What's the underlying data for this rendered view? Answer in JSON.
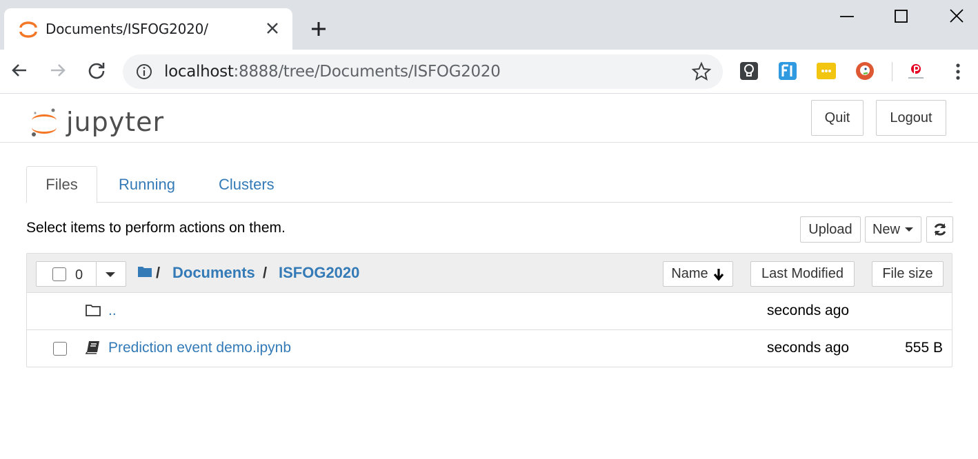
{
  "browser": {
    "tab_title": "Documents/ISFOG2020/",
    "url_host": "localhost",
    "url_rest": ":8888/tree/Documents/ISFOG2020",
    "extension_icons": [
      "lightbulb-icon",
      "fi-icon",
      "dots-icon",
      "duckduckgo-icon",
      "pinterest-icon"
    ]
  },
  "header": {
    "logo_text": "jupyter",
    "quit_label": "Quit",
    "logout_label": "Logout"
  },
  "tabs": [
    {
      "label": "Files",
      "active": true
    },
    {
      "label": "Running",
      "active": false
    },
    {
      "label": "Clusters",
      "active": false
    }
  ],
  "actions": {
    "hint": "Select items to perform actions on them.",
    "upload_label": "Upload",
    "new_label": "New"
  },
  "list": {
    "selected_count": "0",
    "breadcrumb": [
      "Documents",
      "ISFOG2020"
    ],
    "breadcrumb_sep": "/",
    "columns": {
      "name": "Name",
      "last_modified": "Last Modified",
      "file_size": "File size"
    },
    "rows": [
      {
        "name": "..",
        "modified": "seconds ago",
        "size": ""
      },
      {
        "name": "Prediction event demo.ipynb",
        "modified": "seconds ago",
        "size": "555 B"
      }
    ]
  },
  "colors": {
    "link": "#337ab7",
    "jupyter_orange": "#f37726",
    "chrome_bg": "#dee1e6"
  }
}
